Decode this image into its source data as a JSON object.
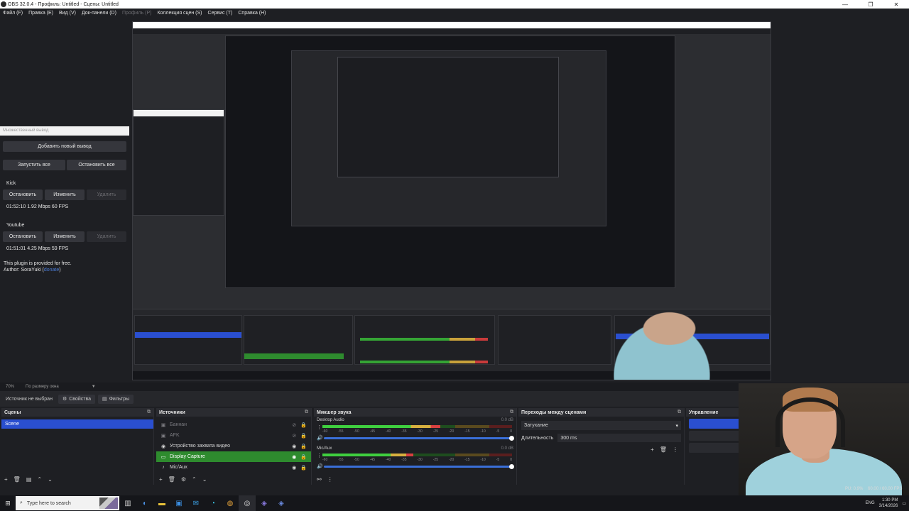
{
  "window": {
    "title": "OBS 32.0.4 - Профиль: Untitled - Сцены: Untitled",
    "controls": [
      "—",
      "❐",
      "✕"
    ]
  },
  "menu": {
    "items": [
      {
        "label": "Файл (F)",
        "disabled": false
      },
      {
        "label": "Правка (E)",
        "disabled": false
      },
      {
        "label": "Вид (V)",
        "disabled": false
      },
      {
        "label": "Док-панели (D)",
        "disabled": false
      },
      {
        "label": "Профиль (P)",
        "disabled": true
      },
      {
        "label": "Коллекция сцен (S)",
        "disabled": false
      },
      {
        "label": "Сервис (T)",
        "disabled": false
      },
      {
        "label": "Справка (H)",
        "disabled": false
      }
    ]
  },
  "multi_output": {
    "title": "Множественный вывод",
    "add_button": "Добавить новый вывод",
    "start_all": "Запустить все",
    "stop_all": "Остановить все",
    "outputs": [
      {
        "name": "Kick",
        "stop": "Остановить",
        "edit": "Изменить",
        "delete": "Удалить",
        "stats": "01:52:10  1.92 Mbps  60 FPS"
      },
      {
        "name": "Youtube",
        "stop": "Остановить",
        "edit": "Изменить",
        "delete": "Удалить",
        "stats": "01:51:01  4.25 Mbps  59 FPS"
      }
    ],
    "note": "This plugin is provided for free.",
    "author_prefix": "Author: SoraYuki (",
    "author_link": "donate",
    "author_suffix": ")"
  },
  "zoom": {
    "level": "70%",
    "fit": "По размеру окна"
  },
  "toolbar": {
    "no_source": "Источник не выбран",
    "properties": "Свойства",
    "filters": "Фильтры"
  },
  "scenes": {
    "title": "Сцены",
    "items": [
      "Scene"
    ]
  },
  "sources": {
    "title": "Источники",
    "items": [
      {
        "label": "Баннан",
        "icon": "image-icon",
        "glyph": "▣",
        "visible": false,
        "dim": true,
        "selected": false
      },
      {
        "label": "AFK",
        "icon": "image-icon",
        "glyph": "▣",
        "visible": false,
        "dim": true,
        "selected": false
      },
      {
        "label": "Устройство захвата видео",
        "icon": "camera-icon",
        "glyph": "◉",
        "visible": true,
        "dim": false,
        "selected": false
      },
      {
        "label": "Display Capture",
        "icon": "monitor-icon",
        "glyph": "▭",
        "visible": true,
        "dim": false,
        "selected": true
      },
      {
        "label": "Mic/Aux",
        "icon": "microphone-icon",
        "glyph": "♪",
        "visible": true,
        "dim": false,
        "selected": false
      }
    ]
  },
  "mixer": {
    "title": "Микшер звука",
    "channels": [
      {
        "name": "Desktop Audio",
        "db": "0.0 dB",
        "level": 0.62
      },
      {
        "name": "Mic/Aux",
        "db": "0.0 dB",
        "level": 0.48
      }
    ],
    "ticks": [
      "-60",
      "-55",
      "-50",
      "-45",
      "-40",
      "-35",
      "-30",
      "-25",
      "-20",
      "-15",
      "-10",
      "-5",
      "0"
    ]
  },
  "transitions": {
    "title": "Переходы между сценами",
    "selected": "Затухание",
    "duration_label": "Длительность",
    "duration_value": "300 ms"
  },
  "controls": {
    "title": "Управление",
    "partial_label": "дио"
  },
  "stats": {
    "cpu": "PU: 0.9%",
    "fps": "60.00 / 60.00 FPS"
  },
  "taskbar": {
    "search_placeholder": "Type here to search",
    "lang": "ENG",
    "time": "1:30 PM",
    "date": "3/14/2026"
  },
  "colors": {
    "accent_blue": "#2a4fd0",
    "selected_green": "#2e8b2e",
    "background": "#1e1f23"
  }
}
